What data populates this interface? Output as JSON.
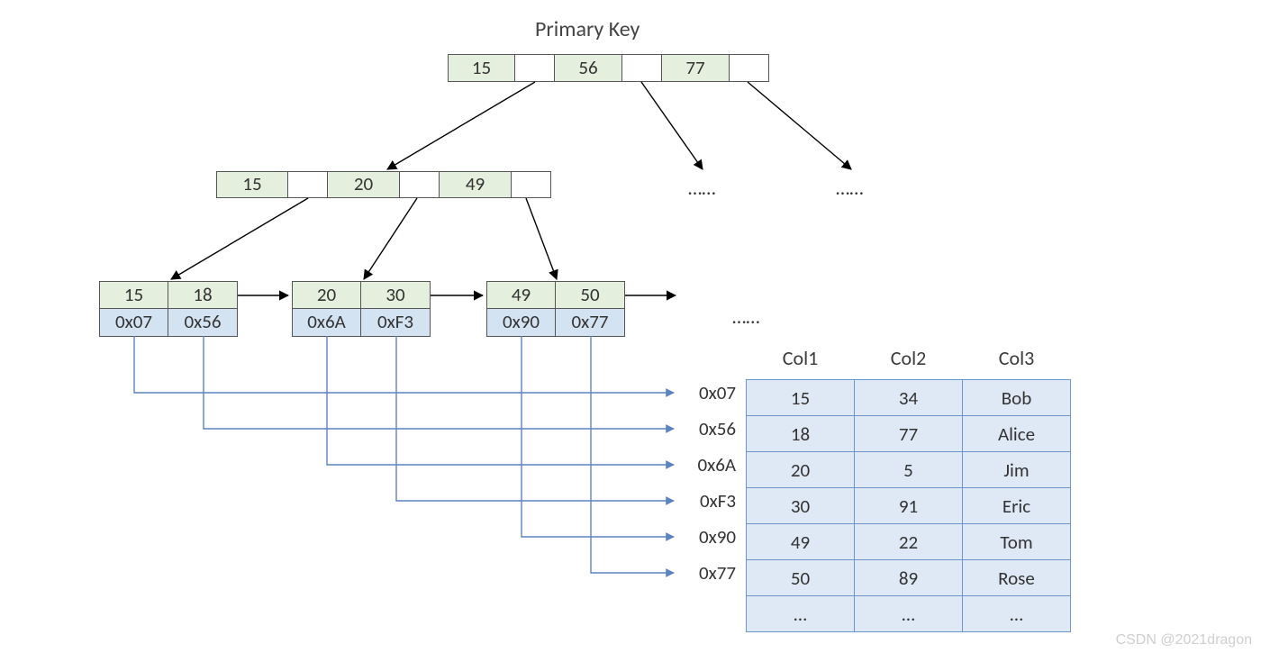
{
  "title": "Primary Key",
  "root": {
    "keys": [
      "15",
      "56",
      "77"
    ]
  },
  "mid": {
    "keys": [
      "15",
      "20",
      "49"
    ]
  },
  "mid_ellipsis": [
    "……",
    "……"
  ],
  "leaves": [
    {
      "keys": [
        "15",
        "18"
      ],
      "ptrs": [
        "0x07",
        "0x56"
      ]
    },
    {
      "keys": [
        "20",
        "30"
      ],
      "ptrs": [
        "0x6A",
        "0xF3"
      ]
    },
    {
      "keys": [
        "49",
        "50"
      ],
      "ptrs": [
        "0x90",
        "0x77"
      ]
    }
  ],
  "leaf_ellipsis": "……",
  "table": {
    "cols": [
      "Col1",
      "Col2",
      "Col3"
    ],
    "rows": [
      {
        "addr": "0x07",
        "c1": "15",
        "c2": "34",
        "c3": "Bob"
      },
      {
        "addr": "0x56",
        "c1": "18",
        "c2": "77",
        "c3": "Alice"
      },
      {
        "addr": "0x6A",
        "c1": "20",
        "c2": "5",
        "c3": "Jim"
      },
      {
        "addr": "0xF3",
        "c1": "30",
        "c2": "91",
        "c3": "Eric"
      },
      {
        "addr": "0x90",
        "c1": "49",
        "c2": "22",
        "c3": "Tom"
      },
      {
        "addr": "0x77",
        "c1": "50",
        "c2": "89",
        "c3": "Rose"
      },
      {
        "addr": "",
        "c1": "…",
        "c2": "…",
        "c3": "…"
      }
    ]
  },
  "watermark": "CSDN @2021dragon"
}
